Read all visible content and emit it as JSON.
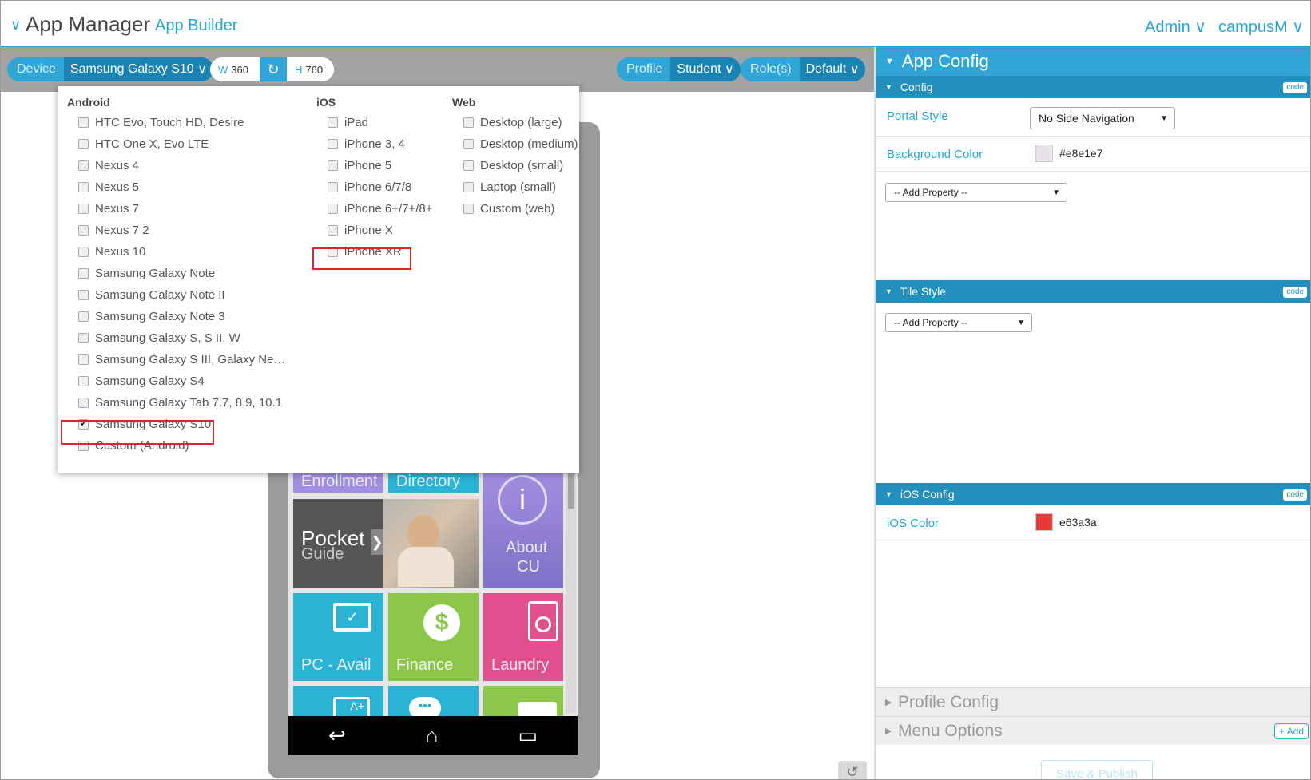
{
  "header": {
    "title": "App Manager",
    "subtitle": "App Builder",
    "admin_menu": "Admin",
    "org_menu": "campusM"
  },
  "toolbar": {
    "device_label": "Device",
    "device_value": "Samsung Galaxy S10",
    "width_label": "W",
    "width_value": "360",
    "height_label": "H",
    "height_value": "760",
    "profile_label": "Profile",
    "profile_value": "Student",
    "roles_label": "Role(s)",
    "roles_value": "Default"
  },
  "device_menu": {
    "columns": [
      {
        "heading": "Android",
        "items": [
          {
            "label": "HTC Evo, Touch HD, Desire",
            "checked": false
          },
          {
            "label": "HTC One X, Evo LTE",
            "checked": false
          },
          {
            "label": "Nexus 4",
            "checked": false
          },
          {
            "label": "Nexus 5",
            "checked": false
          },
          {
            "label": "Nexus 7",
            "checked": false
          },
          {
            "label": "Nexus 7 2",
            "checked": false
          },
          {
            "label": "Nexus 10",
            "checked": false
          },
          {
            "label": "Samsung Galaxy Note",
            "checked": false
          },
          {
            "label": "Samsung Galaxy Note II",
            "checked": false
          },
          {
            "label": "Samsung Galaxy Note 3",
            "checked": false
          },
          {
            "label": "Samsung Galaxy S, S II, W",
            "checked": false
          },
          {
            "label": "Samsung Galaxy S III, Galaxy Ne…",
            "checked": false
          },
          {
            "label": "Samsung Galaxy S4",
            "checked": false
          },
          {
            "label": "Samsung Galaxy Tab 7.7, 8.9, 10.1",
            "checked": false
          },
          {
            "label": "Samsung Galaxy S10",
            "checked": true
          },
          {
            "label": "Custom (Android)",
            "checked": false
          }
        ]
      },
      {
        "heading": "iOS",
        "items": [
          {
            "label": "iPad",
            "checked": false
          },
          {
            "label": "iPhone 3, 4",
            "checked": false
          },
          {
            "label": "iPhone 5",
            "checked": false
          },
          {
            "label": "iPhone 6/7/8",
            "checked": false
          },
          {
            "label": "iPhone 6+/7+/8+",
            "checked": false
          },
          {
            "label": "iPhone X",
            "checked": false
          },
          {
            "label": "iPhone XR",
            "checked": false
          }
        ]
      },
      {
        "heading": "Web",
        "items": [
          {
            "label": "Desktop (large)",
            "checked": false
          },
          {
            "label": "Desktop (medium)",
            "checked": false
          },
          {
            "label": "Desktop (small)",
            "checked": false
          },
          {
            "label": "Laptop (small)",
            "checked": false
          },
          {
            "label": "Custom (web)",
            "checked": false
          }
        ]
      }
    ]
  },
  "preview": {
    "tiles": {
      "enrollment": "Enrollment",
      "directory": "Directory",
      "pocket_line1": "Pocket",
      "pocket_line2": "Guide",
      "about_line1": "About",
      "about_line2": "CU",
      "pc_avail": "PC - Avail",
      "finance": "Finance",
      "laundry": "Laundry"
    },
    "colors": {
      "purple": "#a08fe0",
      "cyan": "#2ab3d4",
      "dark": "#555555",
      "green": "#8dc74a",
      "pink": "#e0508e"
    }
  },
  "panel": {
    "title": "App Config",
    "config": {
      "section": "Config",
      "code_label": "code",
      "portal_style_label": "Portal Style",
      "portal_style_value": "No Side Navigation",
      "background_color_label": "Background Color",
      "background_color_value": "#e8e1e7",
      "add_property": "-- Add Property --"
    },
    "tile_style": {
      "section": "Tile Style",
      "code_label": "code",
      "add_property": "-- Add Property --"
    },
    "ios_config": {
      "section": "iOS Config",
      "code_label": "code",
      "ios_color_label": "iOS Color",
      "ios_color_value": "e63a3a",
      "ios_color_hex": "#e63a3a"
    },
    "profile_config": "Profile Config",
    "menu_options": "Menu Options",
    "add_button": "+ Add",
    "publish_button": "Save & Publish"
  }
}
